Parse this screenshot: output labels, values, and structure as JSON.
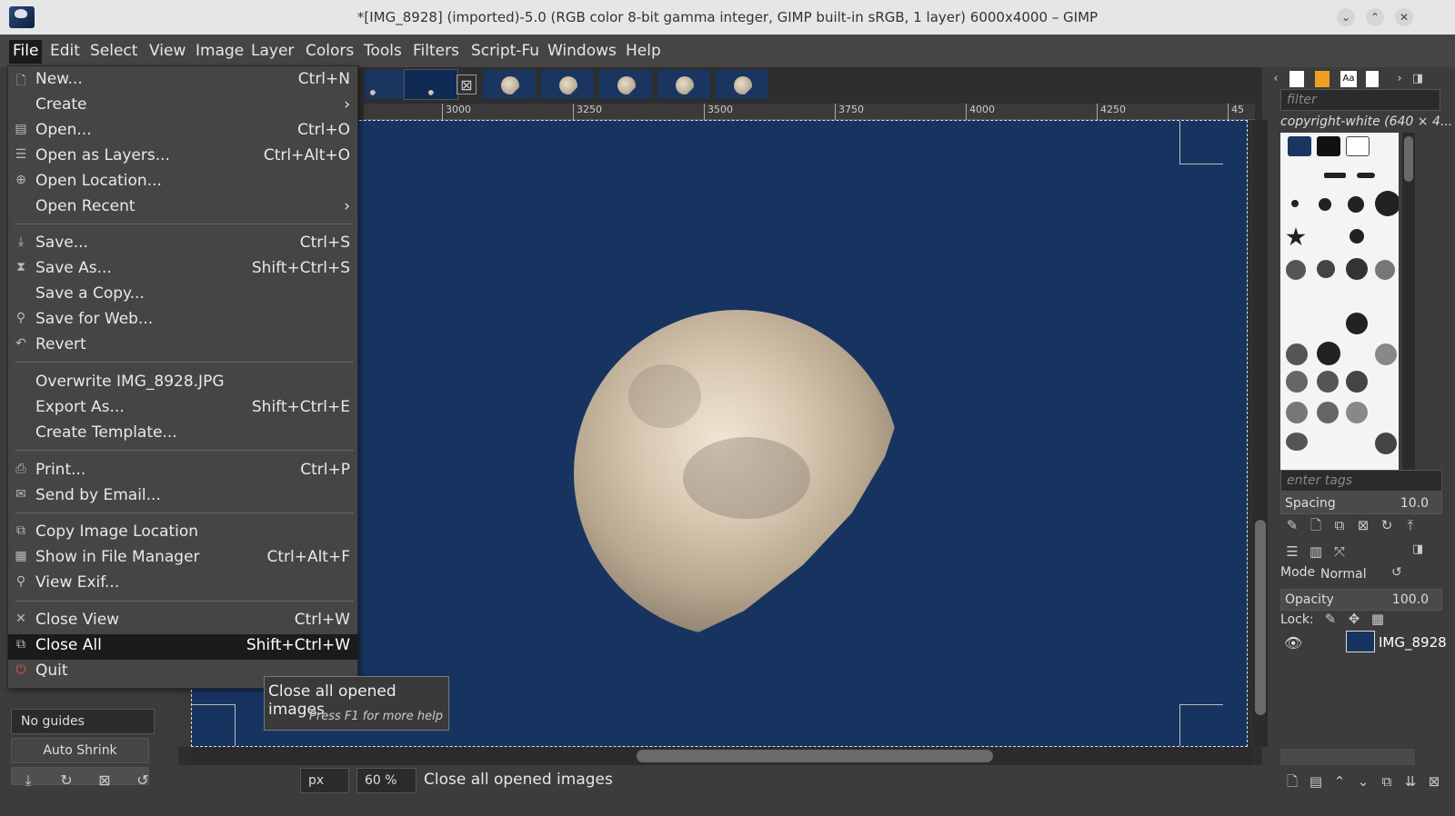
{
  "window": {
    "title": "*[IMG_8928] (imported)-5.0 (RGB color 8-bit gamma integer, GIMP built-in sRGB, 1 layer) 6000x4000 – GIMP",
    "btn_min": "⌄",
    "btn_max": "⌃",
    "btn_close": "✕"
  },
  "menubar": [
    "File",
    "Edit",
    "Select",
    "View",
    "Image",
    "Layer",
    "Colors",
    "Tools",
    "Filters",
    "Script-Fu",
    "Windows",
    "Help"
  ],
  "file_menu": [
    {
      "icon": "🗋",
      "label": "New...",
      "accel": "Ctrl+N"
    },
    {
      "icon": "",
      "label": "Create",
      "accel": "›"
    },
    {
      "icon": "▤",
      "label": "Open...",
      "accel": "Ctrl+O"
    },
    {
      "icon": "☰",
      "label": "Open as Layers...",
      "accel": "Ctrl+Alt+O"
    },
    {
      "icon": "⊕",
      "label": "Open Location...",
      "accel": ""
    },
    {
      "icon": "",
      "label": "Open Recent",
      "accel": "›"
    },
    {
      "icon": "⤓",
      "label": "Save...",
      "accel": "Ctrl+S"
    },
    {
      "icon": "⧗",
      "label": "Save As...",
      "accel": "Shift+Ctrl+S"
    },
    {
      "icon": "",
      "label": "Save a Copy...",
      "accel": ""
    },
    {
      "icon": "⚲",
      "label": "Save for Web...",
      "accel": ""
    },
    {
      "icon": "↶",
      "label": "Revert",
      "accel": ""
    },
    {
      "icon": "",
      "label": "Overwrite IMG_8928.JPG",
      "accel": ""
    },
    {
      "icon": "",
      "label": "Export As...",
      "accel": "Shift+Ctrl+E"
    },
    {
      "icon": "",
      "label": "Create Template...",
      "accel": ""
    },
    {
      "icon": "⎙",
      "label": "Print...",
      "accel": "Ctrl+P"
    },
    {
      "icon": "✉",
      "label": "Send by Email...",
      "accel": ""
    },
    {
      "icon": "⧉",
      "label": "Copy Image Location",
      "accel": ""
    },
    {
      "icon": "▦",
      "label": "Show in File Manager",
      "accel": "Ctrl+Alt+F"
    },
    {
      "icon": "⚲",
      "label": "View Exif...",
      "accel": ""
    },
    {
      "icon": "✕",
      "label": "Close View",
      "accel": "Ctrl+W"
    },
    {
      "icon": "⧉",
      "label": "Close All",
      "accel": "Shift+Ctrl+W"
    },
    {
      "icon": "⏻",
      "label": "Quit",
      "accel": ""
    }
  ],
  "tooltip": {
    "main": "Close all opened images",
    "help": "Press F1 for more help"
  },
  "ruler": [
    "3000",
    "3250",
    "3500",
    "3750",
    "4000",
    "4250",
    "45"
  ],
  "status": {
    "unit": "px",
    "zoom": "60 %",
    "message": "Close all opened images"
  },
  "toolbox": {
    "guides": "No guides",
    "auto_shrink": "Auto Shrink"
  },
  "dock": {
    "filter_placeholder": "filter",
    "brush_name": "copyright-white (640 × 4...",
    "tags_placeholder": "enter tags",
    "spacing_label": "Spacing",
    "spacing_value": "10.0",
    "mode_label": "Mode",
    "mode_value": "Normal",
    "opacity_label": "Opacity",
    "opacity_value": "100.0",
    "lock_label": "Lock:",
    "layer_name": "IMG_8928"
  },
  "colors": {
    "canvas": "#173461",
    "menu_bg": "#454545",
    "highlight": "#1b1b1b"
  }
}
